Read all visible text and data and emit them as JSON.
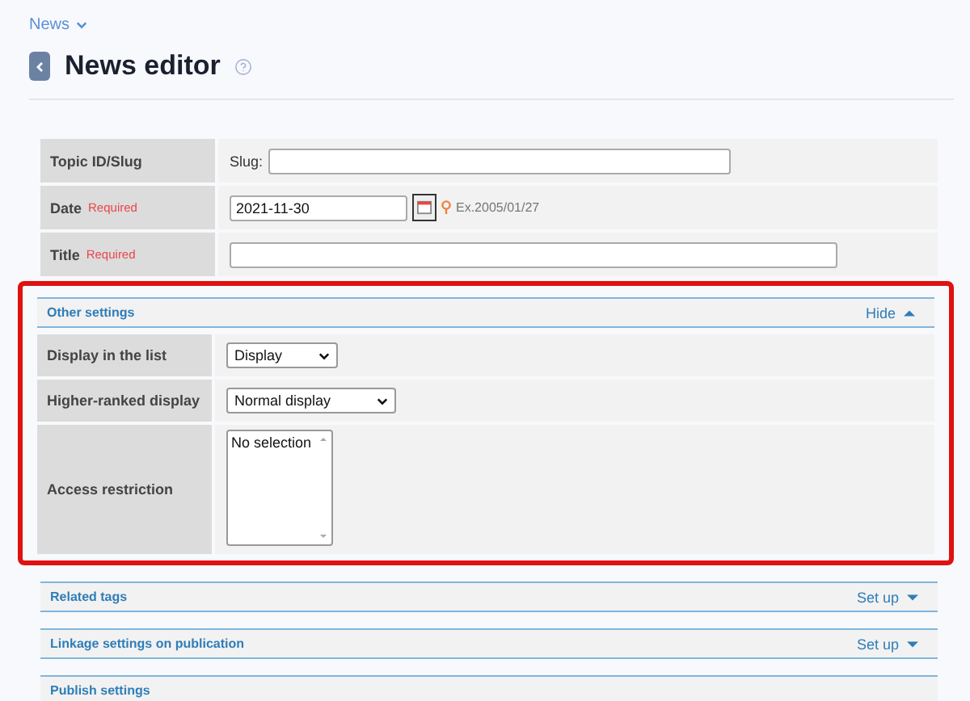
{
  "breadcrumb": {
    "label": "News"
  },
  "page": {
    "title": "News editor"
  },
  "form": {
    "rows": [
      {
        "kind": "slug",
        "label": "Topic ID/Slug",
        "prefix": "Slug:",
        "value": ""
      },
      {
        "kind": "date",
        "label": "Date",
        "required": "Required",
        "value": "2021-11-30",
        "hint": "Ex.2005/01/27"
      },
      {
        "kind": "text",
        "label": "Title",
        "required": "Required",
        "value": ""
      }
    ]
  },
  "sections": [
    {
      "title": "Other settings",
      "toggle": "Hide",
      "expanded": true,
      "highlighted": true,
      "rows": [
        {
          "kind": "select",
          "label": "Display in the list",
          "value": "Display"
        },
        {
          "kind": "select",
          "label": "Higher-ranked display",
          "value": "Normal display"
        },
        {
          "kind": "listbox",
          "label": "Access restriction",
          "value": "No selection"
        }
      ]
    },
    {
      "title": "Related tags",
      "toggle": "Set up",
      "expanded": false,
      "highlighted": false
    },
    {
      "title": "Linkage settings on publication",
      "toggle": "Set up",
      "expanded": false,
      "highlighted": false
    },
    {
      "title": "Publish settings",
      "expanded": false,
      "highlighted": false
    }
  ]
}
